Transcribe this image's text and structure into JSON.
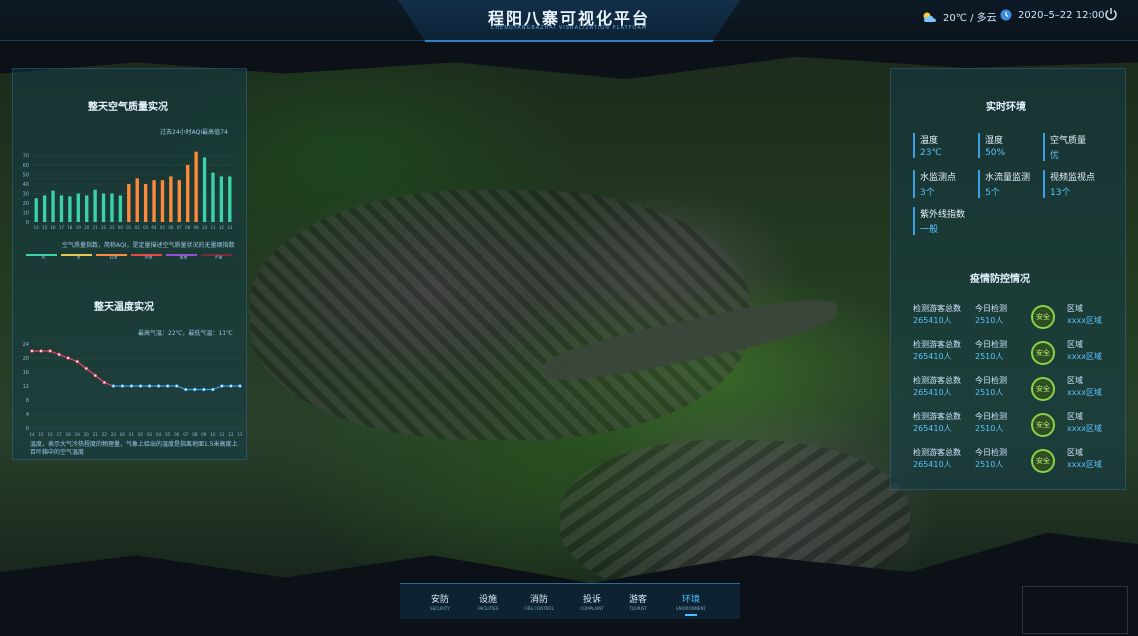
{
  "header": {
    "title": "程阳八寨可视化平台",
    "subtitle": "CHENGYANGBAZHAI VISUALIZATION PLATFORM",
    "weather": "20℃ / 多云",
    "datetime": "2020–5–22 12:00"
  },
  "left_panel": {
    "aqi_title": "整天空气质量实况",
    "aqi_note": "过去24小时AQI最高值74",
    "aqi_caption": "空气质量指数，简称AQI，是定量描述空气质量状况的无量纲指数",
    "temp_title": "整天温度实况",
    "temp_note": "最高气温：22℃，最低气温：11℃",
    "temp_caption": "温度，表示大气冷热程度的物理量，气象上给出的温度是指离地面1.5米高度上百叶箱中的空气温度"
  },
  "chart_data": [
    {
      "type": "bar",
      "title": "整天空气质量实况",
      "categories": [
        "14",
        "15",
        "16",
        "17",
        "18",
        "19",
        "20",
        "21",
        "22",
        "23",
        "00",
        "01",
        "02",
        "03",
        "04",
        "05",
        "06",
        "07",
        "08",
        "09",
        "10",
        "11",
        "12",
        "13"
      ],
      "values": [
        25,
        28,
        33,
        28,
        27,
        30,
        28,
        34,
        30,
        30,
        28,
        40,
        46,
        40,
        44,
        44,
        48,
        44,
        60,
        74,
        68,
        52,
        48,
        48
      ],
      "ylim": [
        0,
        80
      ],
      "yticks": [
        0,
        10,
        20,
        30,
        40,
        50,
        60,
        70
      ],
      "colors": [
        "#3ad2a6",
        "#ff8a3c",
        "#3aa0e8"
      ],
      "legend": [
        "优",
        "良",
        "轻度",
        "中度",
        "重度",
        "严重"
      ],
      "legend_colors": [
        "#3ad2a6",
        "#e6c84a",
        "#ff8a3c",
        "#e84a4a",
        "#9b4ad6",
        "#7a2a3a"
      ]
    },
    {
      "type": "line",
      "title": "整天温度实况",
      "x": [
        "14",
        "15",
        "16",
        "17",
        "18",
        "19",
        "20",
        "21",
        "22",
        "23",
        "00",
        "01",
        "02",
        "03",
        "04",
        "05",
        "06",
        "07",
        "08",
        "09",
        "10",
        "11",
        "12",
        "13"
      ],
      "y": [
        22,
        22,
        22,
        21,
        20,
        19,
        17,
        15,
        13,
        12,
        12,
        12,
        12,
        12,
        12,
        12,
        12,
        11,
        11,
        11,
        11,
        12,
        12,
        12
      ],
      "ylim": [
        0,
        24
      ],
      "yticks": [
        0,
        4,
        8,
        12,
        16,
        20,
        24
      ],
      "colors": [
        "#e84a6a",
        "#3aa0e8"
      ]
    }
  ],
  "right_panel": {
    "env_title": "实时环境",
    "env": [
      {
        "label": "温度",
        "value": "23℃"
      },
      {
        "label": "湿度",
        "value": "50%"
      },
      {
        "label": "空气质量",
        "value": "优"
      },
      {
        "label": "水监测点",
        "value": "3个"
      },
      {
        "label": "水流量监测",
        "value": "5个"
      },
      {
        "label": "视频监视点",
        "value": "13个"
      },
      {
        "label": "紫外线指数",
        "value": "一般"
      }
    ],
    "epi_title": "疫情防控情况",
    "epi_rows": [
      {
        "a": "检测游客总数",
        "b": "265410人",
        "c": "今日检测",
        "d": "2510人",
        "badge": "安全",
        "e": "区域",
        "f": "xxxx区域"
      },
      {
        "a": "检测游客总数",
        "b": "265410人",
        "c": "今日检测",
        "d": "2510人",
        "badge": "安全",
        "e": "区域",
        "f": "xxxx区域"
      },
      {
        "a": "检测游客总数",
        "b": "265410人",
        "c": "今日检测",
        "d": "2510人",
        "badge": "安全",
        "e": "区域",
        "f": "xxxx区域"
      },
      {
        "a": "检测游客总数",
        "b": "265410人",
        "c": "今日检测",
        "d": "2510人",
        "badge": "安全",
        "e": "区域",
        "f": "xxxx区域"
      },
      {
        "a": "检测游客总数",
        "b": "265410人",
        "c": "今日检测",
        "d": "2510人",
        "badge": "安全",
        "e": "区域",
        "f": "xxxx区域"
      }
    ]
  },
  "nav": [
    {
      "label": "安防",
      "en": "SECURITY"
    },
    {
      "label": "设施",
      "en": "FACILITIES"
    },
    {
      "label": "消防",
      "en": "FIRE CONTROL"
    },
    {
      "label": "投诉",
      "en": "COMPLAINT"
    },
    {
      "label": "游客",
      "en": "TOURIST"
    },
    {
      "label": "环境",
      "en": "ENVIRONMENT",
      "active": true
    }
  ],
  "icons": {
    "weather": "cloud-sun-icon",
    "clock": "clock-icon",
    "power": "power-icon"
  }
}
